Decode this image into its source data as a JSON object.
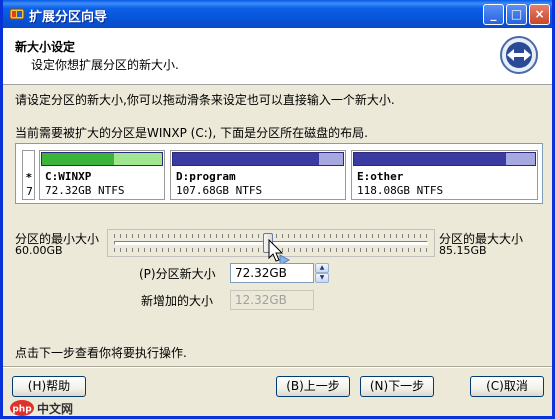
{
  "window": {
    "title": "扩展分区向导",
    "controls": {
      "minimize": "_",
      "maximize": "□",
      "close": "×"
    }
  },
  "header": {
    "title": "新大小设定",
    "subtitle": "设定你想扩展分区的新大小."
  },
  "instruction": "请设定分区的新大小,你可以拖动滑条来设定也可以直接输入一个新大小.",
  "disk_caption": "当前需要被扩大的分区是WINXP (C:), 下面是分区所在磁盘的布局.",
  "disk": {
    "unallocated": {
      "marker": "*",
      "number": "7"
    },
    "partitions": [
      {
        "name": "C:WINXP",
        "size": "72.32GB NTFS",
        "used_fraction": 0.6,
        "color": "#3cb43c",
        "free_color": "#a0e690"
      },
      {
        "name": "D:program",
        "size": "107.68GB NTFS",
        "used_fraction": 0.86,
        "color": "#3a3aa0",
        "free_color": "#a8a8e0"
      },
      {
        "name": "E:other",
        "size": "118.08GB NTFS",
        "used_fraction": 0.84,
        "color": "#3a3aa0",
        "free_color": "#a8a8e0"
      }
    ]
  },
  "slider": {
    "min_label": "分区的最小大小",
    "min_value": "60.00GB",
    "max_label": "分区的最大大小",
    "max_value": "85.15GB",
    "position_fraction": 0.49
  },
  "fields": {
    "new_size_label": "(P)分区新大小",
    "new_size_value": "72.32GB",
    "added_size_label": "新增加的大小",
    "added_size_value": "12.32GB"
  },
  "footer_text": "点击下一步查看你将要执行操作.",
  "buttons": {
    "help": "(H)帮助",
    "back": "(B)上一步",
    "next": "(N)下一步",
    "cancel": "(C)取消"
  },
  "watermark": {
    "text": "中文网",
    "logo": "php"
  }
}
